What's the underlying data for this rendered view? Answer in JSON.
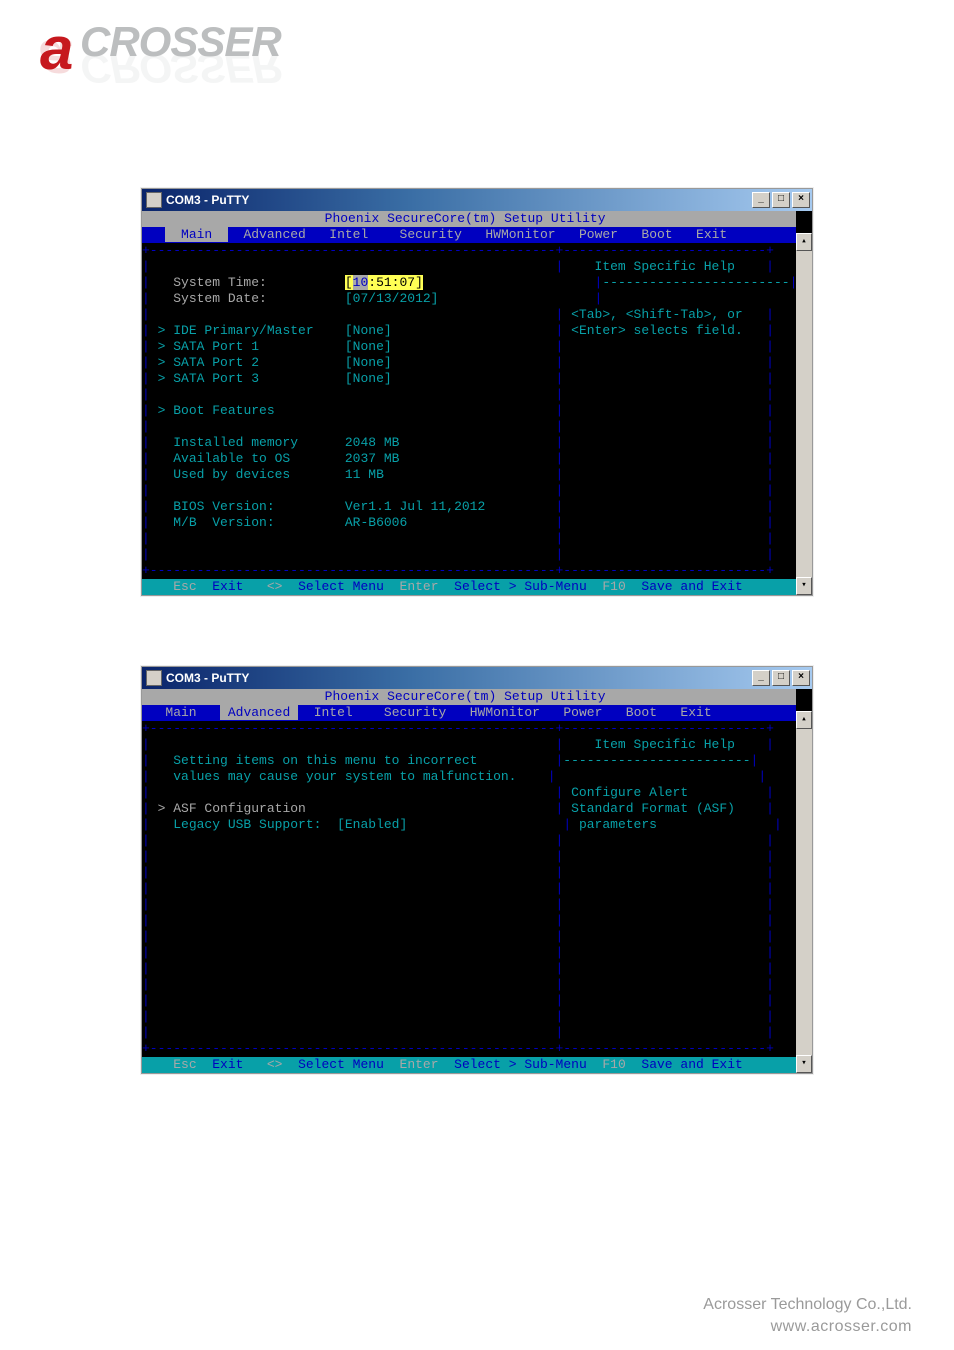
{
  "logo": {
    "letter": "a",
    "rest": "CROSSER"
  },
  "window": {
    "title": "COM3 - PuTTY",
    "min_label": "_",
    "max_label": "□",
    "close_label": "×"
  },
  "utility_title": "Phoenix SecureCore(tm) Setup Utility",
  "tabs": [
    "Main",
    "Advanced",
    "Intel",
    "Security",
    "HWMonitor",
    "Power",
    "Boot",
    "Exit"
  ],
  "screen1": {
    "active_tab": "Main",
    "help_title": "Item Specific Help",
    "help_lines": [
      "<Tab>, <Shift-Tab>, or",
      "<Enter> selects field."
    ],
    "fields": {
      "system_time_label": "System Time:",
      "system_time_value": "10:51:07",
      "system_time_hh": "10",
      "system_time_rest": ":51:07",
      "system_date_label": "System Date:",
      "system_date_value": "[07/13/2012]",
      "ide_primary": "> IDE Primary/Master",
      "ide_primary_val": "[None]",
      "sata1": "> SATA Port 1",
      "sata1_val": "[None]",
      "sata2": "> SATA Port 2",
      "sata2_val": "[None]",
      "sata3": "> SATA Port 3",
      "sata3_val": "[None]",
      "boot_features": "> Boot Features",
      "installed_mem": "Installed memory",
      "installed_mem_val": "2048 MB",
      "avail_os": "Available to OS",
      "avail_os_val": "2037 MB",
      "used_dev": "Used by devices",
      "used_dev_val": "11 MB",
      "bios_ver_label": "BIOS Version:",
      "bios_ver_val": "Ver1.1 Jul 11,2012",
      "mb_ver_label": "M/B  Version:",
      "mb_ver_val": "AR-B6006"
    }
  },
  "screen2": {
    "active_tab": "Advanced",
    "help_title": "Item Specific Help",
    "help_lines": [
      "Configure Alert",
      "Standard Format (ASF)",
      "parameters"
    ],
    "warning1": "Setting items on this menu to incorrect",
    "warning2": "values may cause your system to malfunction.",
    "asf": "> ASF Configuration",
    "legacy_usb_label": "Legacy USB Support:",
    "legacy_usb_val": "[Enabled]"
  },
  "footer": {
    "esc_k": "Esc",
    "esc_t": "Exit",
    "arrows_k": "<>",
    "arrows_t": "Select Menu",
    "enter_k": "Enter",
    "enter_t": "Select > Sub-Menu",
    "f10_k": "F10",
    "f10_t": "Save and Exit"
  },
  "page_footer": {
    "line1": "Acrosser Technology Co.,Ltd.",
    "line2": "www.acrosser.com"
  }
}
